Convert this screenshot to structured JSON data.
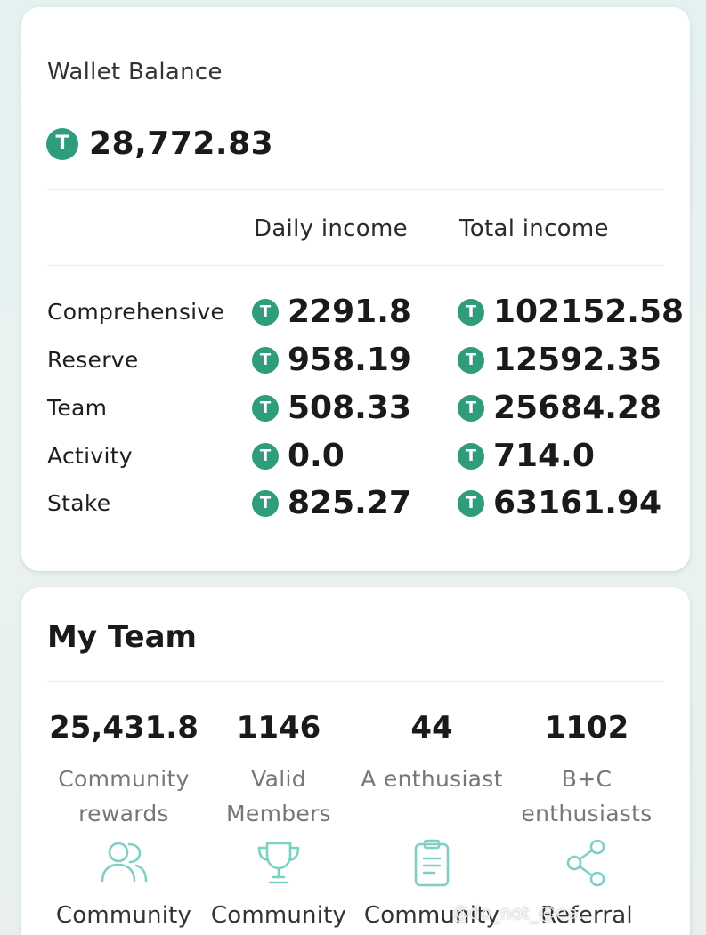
{
  "wallet": {
    "title": "Wallet Balance",
    "balance": "28,772.83",
    "currency_icon": "tether-coin-icon",
    "coin_symbol": "T",
    "coin_color": "#2f9c7b",
    "headers": {
      "daily": "Daily income",
      "total": "Total income"
    },
    "rows": [
      {
        "label": "Comprehensive",
        "daily": "2291.8",
        "total": "102152.58"
      },
      {
        "label": "Reserve",
        "daily": "958.19",
        "total": "12592.35"
      },
      {
        "label": "Team",
        "daily": "508.33",
        "total": "25684.28"
      },
      {
        "label": "Activity",
        "daily": "0.0",
        "total": "714.0"
      },
      {
        "label": "Stake",
        "daily": "825.27",
        "total": "63161.94"
      }
    ]
  },
  "team": {
    "title": "My Team",
    "stats": [
      {
        "value": "25,431.8",
        "label_line1": "Community",
        "label_line2": "rewards"
      },
      {
        "value": "1146",
        "label_line1": "Valid",
        "label_line2": "Members"
      },
      {
        "value": "44",
        "label_line1": "A enthusiast",
        "label_line2": ""
      },
      {
        "value": "1102",
        "label_line1": "B+C",
        "label_line2": "enthusiasts"
      }
    ],
    "links": [
      {
        "icon": "users-icon",
        "label": "Community"
      },
      {
        "icon": "trophy-icon",
        "label": "Community"
      },
      {
        "icon": "clipboard-icon",
        "label": "Community"
      },
      {
        "icon": "share-icon",
        "label": "Referral"
      }
    ],
    "icon_color": "#7fd0c4"
  },
  "watermark": "@do_not_@ea..."
}
